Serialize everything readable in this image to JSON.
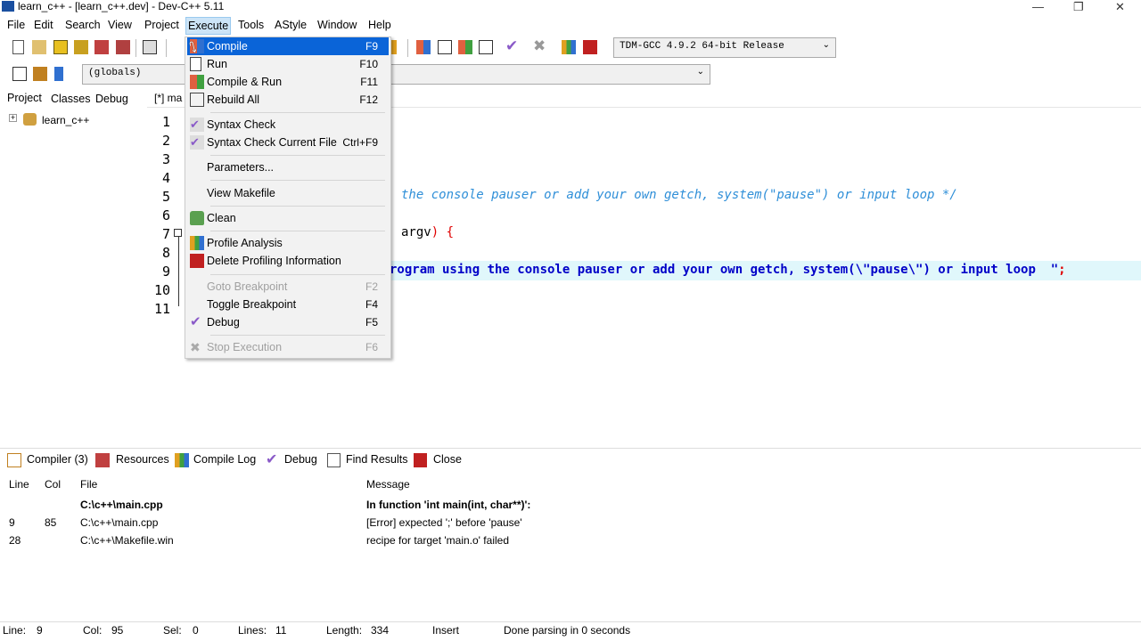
{
  "window": {
    "title": "learn_c++ - [learn_c++.dev] - Dev-C++ 5.11"
  },
  "menubar": [
    "File",
    "Edit",
    "Search",
    "View",
    "Project",
    "Execute",
    "Tools",
    "AStyle",
    "Window",
    "Help"
  ],
  "toolbar": {
    "compiler_select": "TDM-GCC 4.9.2 64-bit Release",
    "scope_select": "(globals)"
  },
  "left_panel": {
    "tabs": [
      "Project",
      "Classes",
      "Debug"
    ],
    "tree_root": "learn_c++"
  },
  "editor": {
    "tab": "[*] ma",
    "line_numbers": [
      "1",
      "2",
      "3",
      "4",
      "5",
      "6",
      "7",
      "8",
      "9",
      "10",
      "11"
    ],
    "visible_code": {
      "line5": "the console pauser or add your own getch, system(\"pause\") or input loop */",
      "line7_id": "argv",
      "line7_punct": ") {",
      "line9_text": "rogram using the console pauser or add your own getch, system(\\\"pause\\\") or input loop  \"",
      "line9_semicolon": ";"
    },
    "current_line": 9
  },
  "execute_menu": {
    "items": [
      {
        "label": "Compile",
        "shortcut": "F9",
        "icon": "compile-icon"
      },
      {
        "label": "Run",
        "shortcut": "F10",
        "icon": "run-icon"
      },
      {
        "label": "Compile & Run",
        "shortcut": "F11",
        "icon": "compile-run-icon"
      },
      {
        "label": "Rebuild All",
        "shortcut": "F12",
        "icon": "rebuild-icon"
      },
      {
        "label": "Syntax Check",
        "shortcut": "",
        "icon": "syntax-check-icon"
      },
      {
        "label": "Syntax Check Current File",
        "shortcut": "Ctrl+F9",
        "icon": "syntax-check-file-icon"
      },
      {
        "label": "Parameters...",
        "shortcut": ""
      },
      {
        "label": "View Makefile",
        "shortcut": ""
      },
      {
        "label": "Clean",
        "shortcut": "",
        "icon": "clean-icon"
      },
      {
        "label": "Profile Analysis",
        "shortcut": "",
        "icon": "profile-icon"
      },
      {
        "label": "Delete Profiling Information",
        "shortcut": "",
        "icon": "delete-profile-icon"
      },
      {
        "label": "Goto Breakpoint",
        "shortcut": "F2",
        "disabled": true
      },
      {
        "label": "Toggle Breakpoint",
        "shortcut": "F4"
      },
      {
        "label": "Debug",
        "shortcut": "F5",
        "icon": "debug-check-icon"
      },
      {
        "label": "Stop Execution",
        "shortcut": "F6",
        "disabled": true,
        "icon": "stop-icon"
      }
    ]
  },
  "bottom_panel": {
    "tabs": [
      "Compiler (3)",
      "Resources",
      "Compile Log",
      "Debug",
      "Find Results",
      "Close"
    ],
    "columns": [
      "Line",
      "Col",
      "File",
      "Message"
    ],
    "rows": [
      {
        "line": "",
        "col": "",
        "file": "C:\\c++\\main.cpp",
        "message": "In function 'int main(int, char**)':"
      },
      {
        "line": "9",
        "col": "85",
        "file": "C:\\c++\\main.cpp",
        "message": "[Error] expected ';' before 'pause'"
      },
      {
        "line": "28",
        "col": "",
        "file": "C:\\c++\\Makefile.win",
        "message": "recipe for target 'main.o' failed"
      }
    ]
  },
  "status": {
    "line_label": "Line:",
    "line": "9",
    "col_label": "Col:",
    "col": "95",
    "sel_label": "Sel:",
    "sel": "0",
    "lines_label": "Lines:",
    "lines": "11",
    "length_label": "Length:",
    "length": "334",
    "mode": "Insert",
    "message": "Done parsing in 0 seconds"
  },
  "colors": {
    "menu_highlight": "#0a64d8",
    "comment": "#2f8fd8",
    "keyword_blue": "#0000c8",
    "error_red": "#e00000"
  }
}
